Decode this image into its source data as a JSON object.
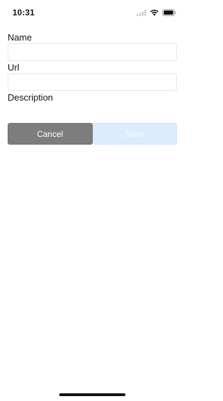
{
  "status_bar": {
    "time": "10:31",
    "icons": [
      "signal-icon",
      "wifi-icon",
      "battery-icon"
    ]
  },
  "form": {
    "name_label": "Name",
    "name_value": "",
    "url_label": "Url",
    "url_value": "",
    "description_label": "Description"
  },
  "buttons": {
    "cancel_label": "Cancel",
    "save_label": "Save"
  },
  "colors": {
    "cancel_bg": "#7d7d7d",
    "save_bg": "#dcecff",
    "save_text": "#f2f8ff"
  }
}
